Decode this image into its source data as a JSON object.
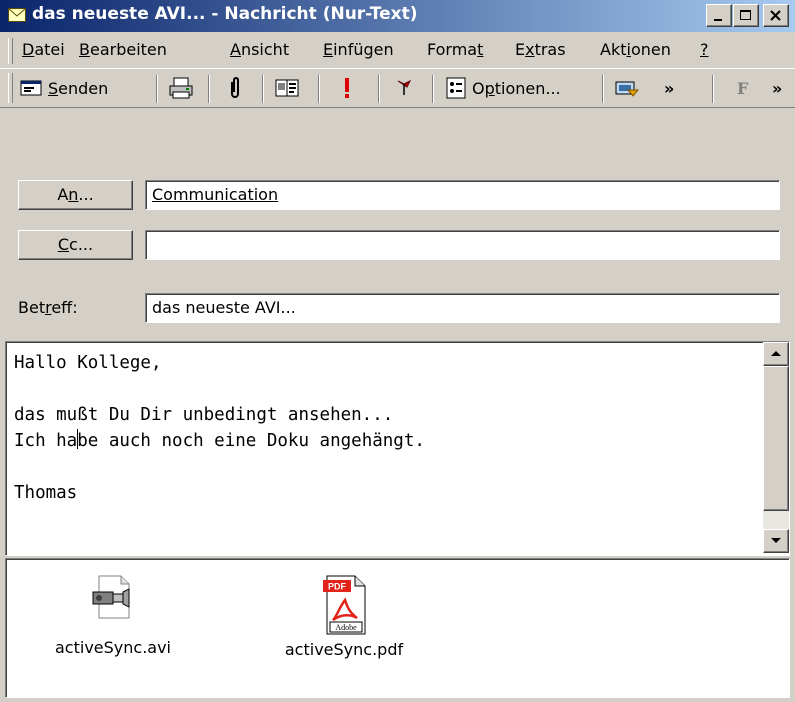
{
  "window": {
    "title": "das neueste AVI... - Nachricht (Nur-Text)"
  },
  "menu": {
    "items": [
      {
        "pre": "",
        "key": "D",
        "post": "atei"
      },
      {
        "pre": "",
        "key": "B",
        "post": "earbeiten"
      },
      {
        "pre": "",
        "key": "A",
        "post": "nsicht"
      },
      {
        "pre": "",
        "key": "E",
        "post": "infügen"
      },
      {
        "pre": "Forma",
        "key": "t",
        "post": ""
      },
      {
        "pre": "E",
        "key": "x",
        "post": "tras"
      },
      {
        "pre": "Akt",
        "key": "i",
        "post": "onen"
      },
      {
        "pre": "",
        "key": "?",
        "post": ""
      }
    ]
  },
  "toolbar": {
    "send_pre": "",
    "send_key": "S",
    "send_post": "enden",
    "options_pre": "O",
    "options_key": "p",
    "options_post": "tionen...",
    "more": "»",
    "format_letter": "F"
  },
  "header": {
    "to_pre": "A",
    "to_key": "n",
    "to_post": "...",
    "to_value": "Communication",
    "cc_key": "C",
    "cc_post": "c...",
    "cc_value": "",
    "subject_pre": "Bet",
    "subject_key": "r",
    "subject_post": "eff:",
    "subject_value": "das neueste AVI..."
  },
  "body": {
    "line1": "Hallo Kollege,",
    "line2": "",
    "line3": "das mußt Du Dir unbedingt ansehen...",
    "line4_before_caret": "Ich ha",
    "line4_after_caret": "be auch noch eine Doku angehängt.",
    "line5": "",
    "line6": "Thomas"
  },
  "attachments": [
    {
      "name": "activeSync.avi",
      "icon": "video-file-icon"
    },
    {
      "name": "activeSync.pdf",
      "icon": "pdf-file-icon",
      "badge": "PDF",
      "brand": "Adobe"
    }
  ],
  "colors": {
    "title_start": "#0a246a",
    "title_end": "#a6caf0",
    "face": "#d4d0c8",
    "pdf_red": "#e2231a"
  }
}
